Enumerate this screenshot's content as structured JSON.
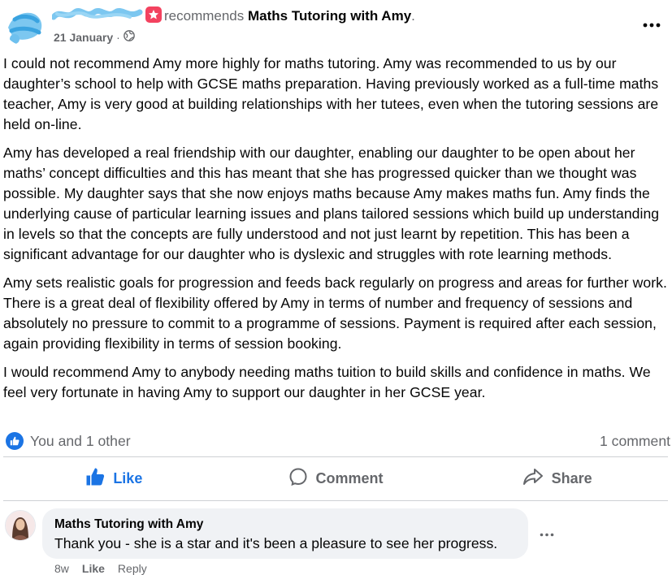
{
  "post": {
    "recommends_word": "recommends",
    "page_name": "Maths Tutoring with Amy",
    "headline_end": ".",
    "date": "21 January",
    "separator": "·",
    "paragraphs": [
      "I could not recommend Amy more highly for maths tutoring. Amy was recommended to us by our daughter’s school to help with GCSE maths preparation. Having previously worked as a full-time maths teacher, Amy is very good at building relationships with her tutees, even when the tutoring sessions are held on-line.",
      "Amy has developed a real friendship with our daughter, enabling our daughter to be open about her maths’ concept difficulties and this has meant that she has progressed quicker than we thought was possible. My daughter says that she now enjoys maths because Amy makes maths fun. Amy finds the underlying cause of particular learning issues and plans tailored sessions which build up understanding in levels so that the concepts are fully understood and not just learnt by repetition. This has been a significant advantage for our daughter who is dyslexic and struggles with rote learning methods.",
      "Amy sets realistic goals for progression and feeds back regularly on progress and areas for further work. There is a great deal of flexibility offered by Amy in terms of number and frequency of sessions and absolutely no pressure to commit to a programme of sessions. Payment is required after each session, again providing flexibility in terms of session booking.",
      "I would recommend Amy to anybody needing maths tuition to build skills and confidence in maths. We feel very fortunate in having Amy to support our daughter in her GCSE year."
    ]
  },
  "reactions": {
    "summary": "You and 1 other",
    "comments_count": "1 comment"
  },
  "actions": {
    "like": "Like",
    "comment": "Comment",
    "share": "Share"
  },
  "comment": {
    "author": "Maths Tutoring with Amy",
    "text": "Thank you - she is a star and it's been a pleasure to see her progress.",
    "age": "8w",
    "like": "Like",
    "reply": "Reply"
  },
  "colors": {
    "accent": "#1b74e4",
    "recommend_badge": "#f3425f",
    "muted_text": "#65676b",
    "bubble": "#f0f2f5"
  },
  "icons": [
    "recommend-star-icon",
    "globe-icon",
    "more-horizontal-icon",
    "like-thumb-icon",
    "comment-icon",
    "share-icon"
  ]
}
